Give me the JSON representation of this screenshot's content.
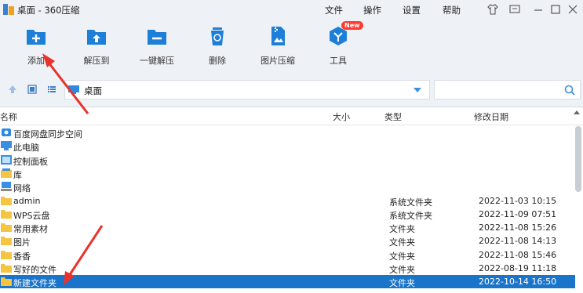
{
  "window": {
    "title": "桌面 - 360压缩"
  },
  "menu": {
    "file": "文件",
    "operate": "操作",
    "settings": "设置",
    "help": "帮助"
  },
  "toolbar": {
    "add": "添加",
    "extract_to": "解压到",
    "one_click_extract": "一键解压",
    "delete": "删除",
    "image_compress": "图片压缩",
    "tools": "工具",
    "tools_badge": "New"
  },
  "address": {
    "path": "桌面"
  },
  "columns": {
    "name": "名称",
    "size": "大小",
    "type": "类型",
    "modified": "修改日期"
  },
  "items": [
    {
      "name": "百度网盘同步空间",
      "type": "",
      "modified": "",
      "icon": "baidu-sync-icon"
    },
    {
      "name": "此电脑",
      "type": "",
      "modified": "",
      "icon": "computer-icon"
    },
    {
      "name": "控制面板",
      "type": "",
      "modified": "",
      "icon": "control-panel-icon"
    },
    {
      "name": "库",
      "type": "",
      "modified": "",
      "icon": "library-icon"
    },
    {
      "name": "网络",
      "type": "",
      "modified": "",
      "icon": "network-icon"
    },
    {
      "name": "admin",
      "type": "系统文件夹",
      "modified": "2022-11-03 10:15",
      "icon": "folder-icon"
    },
    {
      "name": "WPS云盘",
      "type": "系统文件夹",
      "modified": "2022-11-09 07:51",
      "icon": "folder-icon"
    },
    {
      "name": "常用素材",
      "type": "文件夹",
      "modified": "2022-11-08 15:26",
      "icon": "folder-icon"
    },
    {
      "name": "图片",
      "type": "文件夹",
      "modified": "2022-11-08 14:13",
      "icon": "folder-icon"
    },
    {
      "name": "香香",
      "type": "文件夹",
      "modified": "2022-11-08 15:46",
      "icon": "folder-icon"
    },
    {
      "name": "写好的文件",
      "type": "文件夹",
      "modified": "2022-08-19 11:18",
      "icon": "folder-icon"
    },
    {
      "name": "新建文件夹",
      "type": "文件夹",
      "modified": "2022-10-14 16:50",
      "icon": "folder-icon",
      "selected": true
    }
  ],
  "colors": {
    "accent": "#1a74c9",
    "toolbar_icon": "#1e7fd8",
    "folder": "#f5c542",
    "annotation_arrow": "#e8322b"
  }
}
